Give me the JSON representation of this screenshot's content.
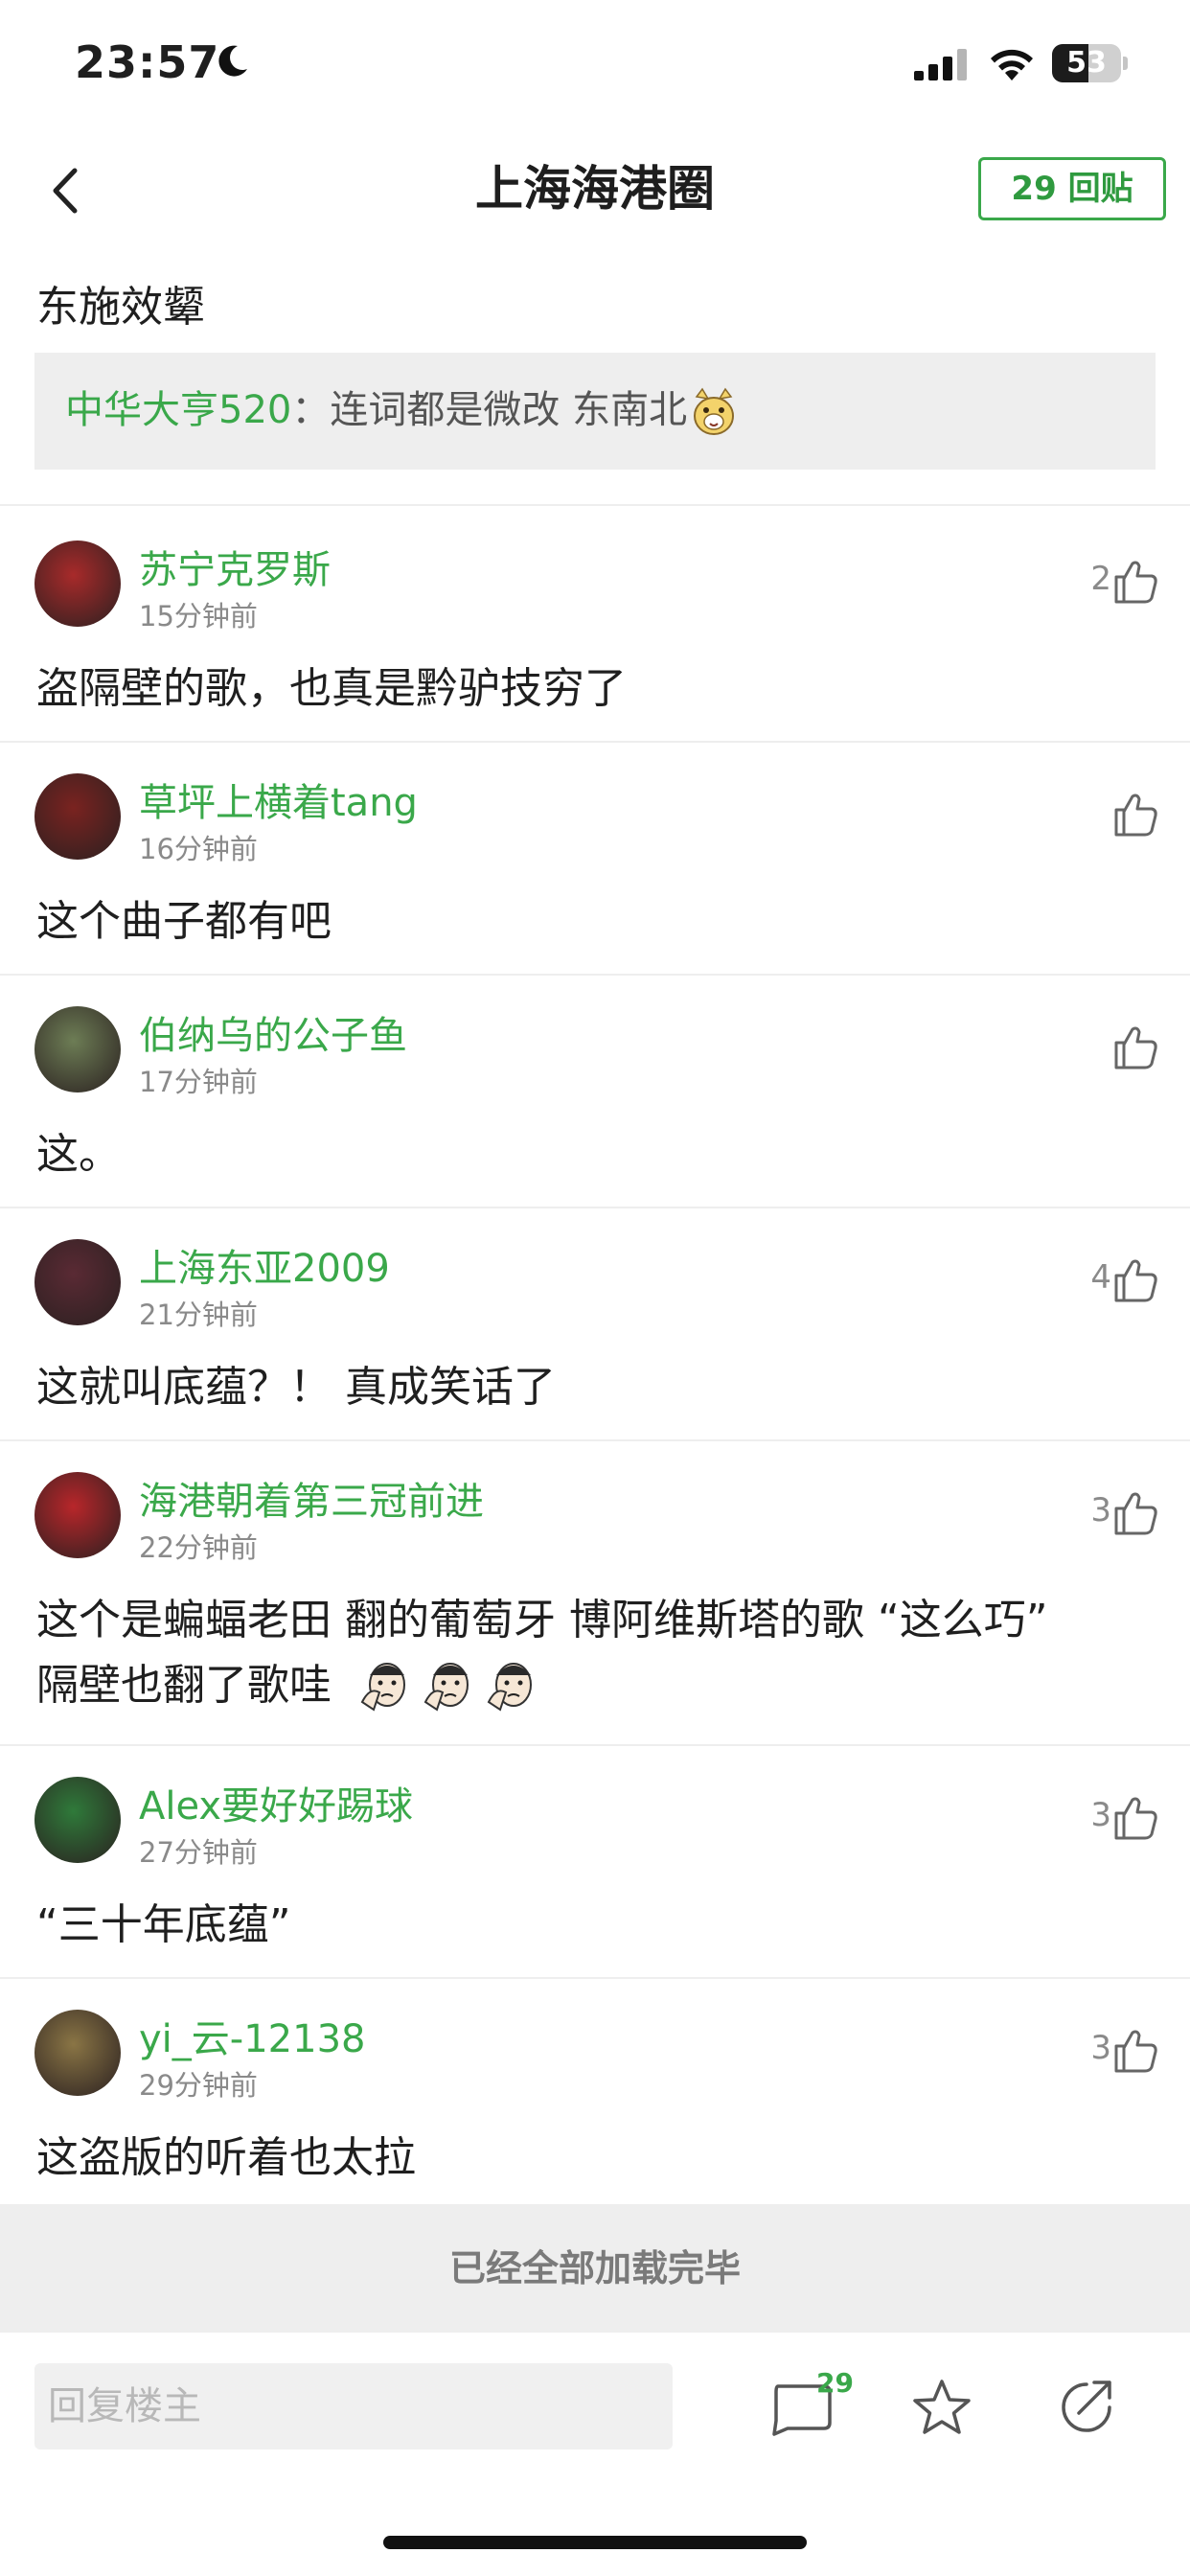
{
  "status_bar": {
    "time": "23:57",
    "battery": "53",
    "battery_level": 0.53
  },
  "nav": {
    "title": "上海海港圈",
    "reply_count_label": "29 回贴"
  },
  "op": {
    "content": "东施效颦",
    "quote": {
      "author": "中华大亨520",
      "separator": "：",
      "text": "连词都是微改 东南北"
    }
  },
  "comments": [
    {
      "user": "苏宁克罗斯",
      "time": "15分钟前",
      "likes": "2",
      "text": [
        "盗隔壁的歌，也真是黔驴技穷了"
      ],
      "avatar_color": "#a82a2a"
    },
    {
      "user": "草坪上横着tang",
      "time": "16分钟前",
      "likes": "",
      "text": [
        "这个曲子都有吧"
      ],
      "avatar_color": "#7a2320"
    },
    {
      "user": "伯纳乌的公子鱼",
      "time": "17分钟前",
      "likes": "",
      "text": [
        "这。"
      ],
      "avatar_color": "#6d7d55"
    },
    {
      "user": "上海东亚2009",
      "time": "21分钟前",
      "likes": "4",
      "text": [
        "这就叫底蕴？！ 真成笑话了"
      ],
      "avatar_color": "#5a2a34"
    },
    {
      "user": "海港朝着第三冠前进",
      "time": "22分钟前",
      "likes": "3",
      "text": [
        "这个是蝙蝠老田 翻的葡萄牙 博阿维斯塔的歌 “这么巧”",
        "隔壁也翻了歌哇"
      ],
      "avatar_color": "#b8262a"
    },
    {
      "user": "Alex要好好踢球",
      "time": "27分钟前",
      "likes": "3",
      "text": [
        "“三十年底蕴”"
      ],
      "avatar_color": "#2f7a3a"
    },
    {
      "user": "yi_云-12138",
      "time": "29分钟前",
      "likes": "3",
      "text": [
        "这盗版的听着也太拉"
      ],
      "avatar_color": "#8a7545"
    }
  ],
  "footer": {
    "all_loaded": "已经全部加载完毕",
    "reply_placeholder": "回复楼主",
    "comment_badge": "29"
  },
  "colors": {
    "accent_green": "#3aa84a",
    "gray_text": "#8a8a8a",
    "panel_bg": "#eeeeee"
  }
}
